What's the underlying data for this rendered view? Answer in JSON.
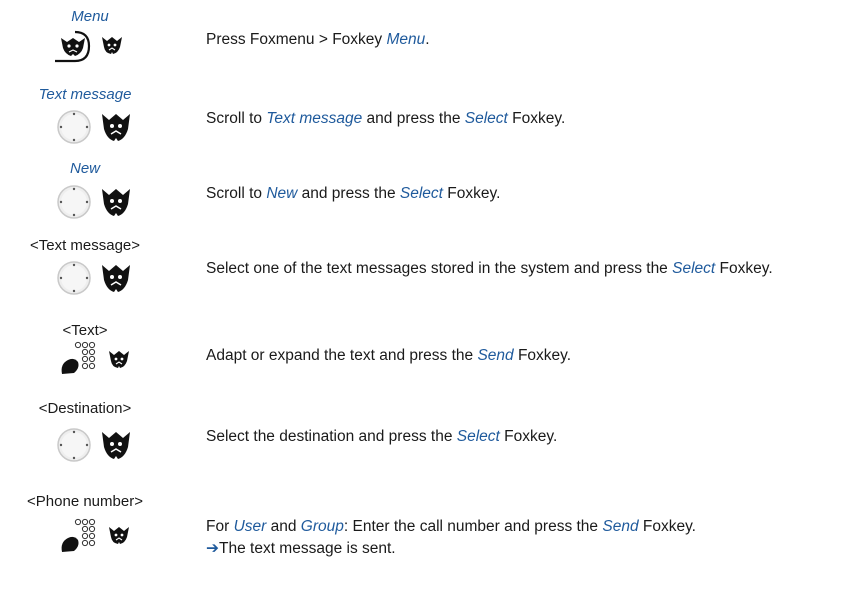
{
  "steps": [
    {
      "label": "Menu",
      "label_style": "italic",
      "icons": [
        "foxmenu-key-icon",
        "foxkey-icon"
      ],
      "parts": [
        {
          "t": "Press Foxmenu > Foxkey ",
          "h": false
        },
        {
          "t": "Menu",
          "h": true
        },
        {
          "t": ".",
          "h": false
        }
      ]
    },
    {
      "label": "Text message",
      "label_style": "italic",
      "icons": [
        "navigation-key-icon",
        "foxkey-icon"
      ],
      "parts": [
        {
          "t": "Scroll to ",
          "h": false
        },
        {
          "t": "Text message",
          "h": true
        },
        {
          "t": " and press the ",
          "h": false
        },
        {
          "t": "Select",
          "h": true
        },
        {
          "t": " Foxkey.",
          "h": false
        }
      ]
    },
    {
      "label": "New",
      "label_style": "italic",
      "icons": [
        "navigation-key-icon",
        "foxkey-icon"
      ],
      "parts": [
        {
          "t": "Scroll to ",
          "h": false
        },
        {
          "t": "New",
          "h": true
        },
        {
          "t": " and press the ",
          "h": false
        },
        {
          "t": "Select",
          "h": true
        },
        {
          "t": " Foxkey.",
          "h": false
        }
      ]
    },
    {
      "label": "<Text message>",
      "label_style": "plain",
      "icons": [
        "navigation-key-icon",
        "foxkey-icon"
      ],
      "parts": [
        {
          "t": "Select one of the text messages stored in the system and press the ",
          "h": false
        },
        {
          "t": "Select",
          "h": true
        },
        {
          "t": " Foxkey.",
          "h": false
        }
      ]
    },
    {
      "label": "<Text>",
      "label_style": "plain",
      "icons": [
        "keypad-icon",
        "foxkey-icon"
      ],
      "parts": [
        {
          "t": "Adapt or expand the text and press the ",
          "h": false
        },
        {
          "t": "Send",
          "h": true
        },
        {
          "t": " Foxkey.",
          "h": false
        }
      ]
    },
    {
      "label": "<Destination>",
      "label_style": "plain",
      "icons": [
        "navigation-key-icon",
        "foxkey-icon"
      ],
      "parts": [
        {
          "t": "Select the destination and press the ",
          "h": false
        },
        {
          "t": "Select",
          "h": true
        },
        {
          "t": " Foxkey.",
          "h": false
        }
      ]
    },
    {
      "label": "<Phone number>",
      "label_style": "plain",
      "icons": [
        "keypad-icon",
        "foxkey-icon"
      ],
      "parts": [
        {
          "t": "For ",
          "h": false
        },
        {
          "t": "User",
          "h": true
        },
        {
          "t": " and ",
          "h": false
        },
        {
          "t": "Group",
          "h": true
        },
        {
          "t": ": Enter the call number and press the ",
          "h": false
        },
        {
          "t": "Send",
          "h": true
        },
        {
          "t": " Foxkey.",
          "h": false
        }
      ],
      "result_arrow": "➔",
      "result": "The text message is sent."
    }
  ]
}
